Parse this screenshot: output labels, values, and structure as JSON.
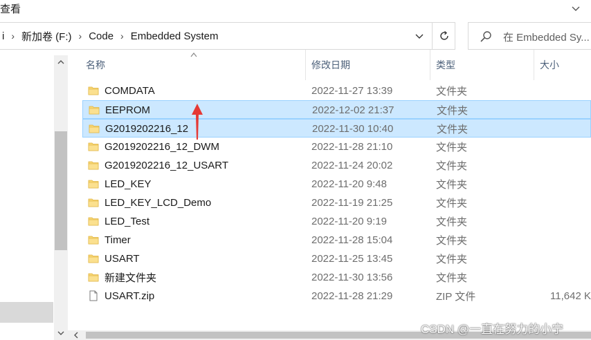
{
  "menubar": {
    "label": "查看"
  },
  "address": {
    "crumbs": [
      "i",
      "新加卷 (F:)",
      "Code",
      "Embedded System"
    ],
    "separator": "›"
  },
  "search": {
    "placeholder": "在 Embedded Sy..."
  },
  "columns": {
    "name": "名称",
    "date": "修改日期",
    "type": "类型",
    "size": "大小"
  },
  "files": [
    {
      "name": "COMDATA",
      "date": "2022-11-27 13:39",
      "type": "文件夹",
      "size": "",
      "icon": "folder-icon",
      "selected": false
    },
    {
      "name": "EEPROM",
      "date": "2022-12-02 21:37",
      "type": "文件夹",
      "size": "",
      "icon": "folder-icon",
      "selected": true
    },
    {
      "name": "G2019202216_12",
      "date": "2022-11-30 10:40",
      "type": "文件夹",
      "size": "",
      "icon": "folder-icon",
      "selected": true
    },
    {
      "name": "G2019202216_12_DWM",
      "date": "2022-11-28 21:10",
      "type": "文件夹",
      "size": "",
      "icon": "folder-icon",
      "selected": false
    },
    {
      "name": "G2019202216_12_USART",
      "date": "2022-11-24 20:02",
      "type": "文件夹",
      "size": "",
      "icon": "folder-icon",
      "selected": false
    },
    {
      "name": "LED_KEY",
      "date": "2022-11-20 9:48",
      "type": "文件夹",
      "size": "",
      "icon": "folder-icon",
      "selected": false
    },
    {
      "name": "LED_KEY_LCD_Demo",
      "date": "2022-11-19 21:25",
      "type": "文件夹",
      "size": "",
      "icon": "folder-icon",
      "selected": false
    },
    {
      "name": "LED_Test",
      "date": "2022-11-20 9:19",
      "type": "文件夹",
      "size": "",
      "icon": "folder-icon",
      "selected": false
    },
    {
      "name": "Timer",
      "date": "2022-11-28 15:04",
      "type": "文件夹",
      "size": "",
      "icon": "folder-icon",
      "selected": false
    },
    {
      "name": "USART",
      "date": "2022-11-25 13:45",
      "type": "文件夹",
      "size": "",
      "icon": "folder-icon",
      "selected": false
    },
    {
      "name": "新建文件夹",
      "date": "2022-11-30 13:56",
      "type": "文件夹",
      "size": "",
      "icon": "folder-icon",
      "selected": false
    },
    {
      "name": "USART.zip",
      "date": "2022-11-28 21:29",
      "type": "ZIP 文件",
      "size": "11,642 K",
      "icon": "zip-file-icon",
      "selected": false
    }
  ],
  "watermark": "CSDN @一直在努力的小宁",
  "colors": {
    "selection": "#cce8ff",
    "selection_border": "#99d1ff",
    "folder": "#f8d775",
    "annotation": "#e53935"
  }
}
